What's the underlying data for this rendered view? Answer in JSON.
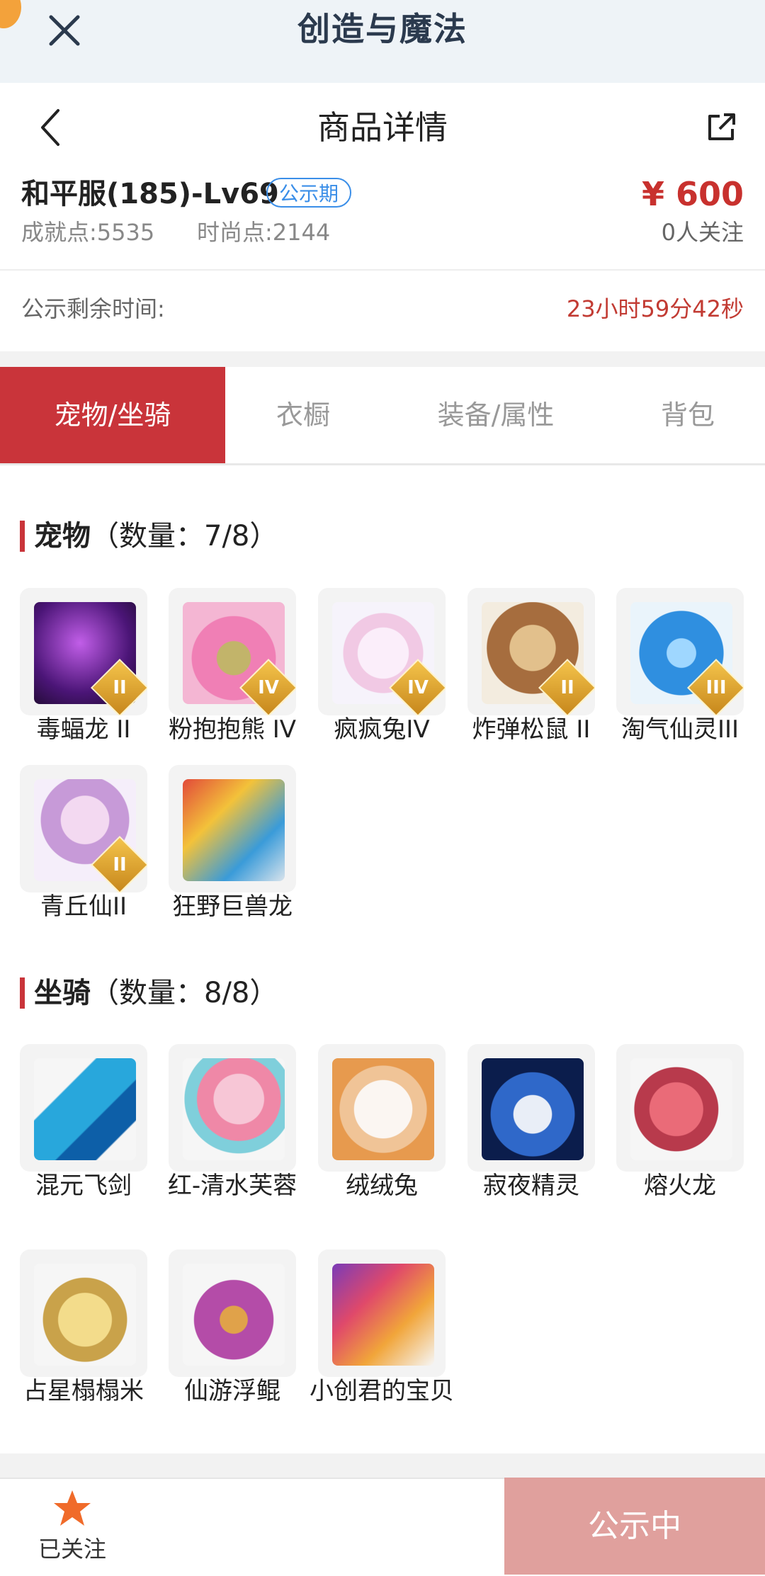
{
  "app": {
    "title": "创造与魔法"
  },
  "nav": {
    "title": "商品详情"
  },
  "item": {
    "name": "和平服(185)-Lv69",
    "badge": "公示期",
    "price": "¥ 600",
    "achievement_label": "成就点:",
    "achievement_value": "5535",
    "fashion_label": "时尚点:",
    "fashion_value": "2144",
    "followers": "0人关注"
  },
  "countdown": {
    "label": "公示剩余时间:",
    "value": "23小时59分42秒"
  },
  "tabs": [
    {
      "label": "宠物/坐骑"
    },
    {
      "label": "衣橱"
    },
    {
      "label": "装备/属性"
    },
    {
      "label": "背包"
    }
  ],
  "pets": {
    "title": "宠物",
    "count": "（数量：7/8）",
    "items": [
      {
        "name": "毒蝠龙 II",
        "tier": "II",
        "color": "#6a2aa8"
      },
      {
        "name": "粉抱抱熊 IV",
        "tier": "IV",
        "color": "#ea6fa8"
      },
      {
        "name": "疯疯兔IV",
        "tier": "IV",
        "color": "#f1d7ec"
      },
      {
        "name": "炸弹松鼠 II",
        "tier": "II",
        "color": "#c89a62"
      },
      {
        "name": "淘气仙灵III",
        "tier": "III",
        "color": "#3fa8e6"
      },
      {
        "name": "青丘仙II",
        "tier": "II",
        "color": "#e7c9ec"
      },
      {
        "name": "狂野巨兽龙",
        "tier": "",
        "color": "#d9a43a"
      }
    ]
  },
  "mounts": {
    "title": "坐骑",
    "count": "（数量：8/8）",
    "items": [
      {
        "name": "混元飞剑",
        "color": "#1f8fd6"
      },
      {
        "name": "红-清水芙蓉",
        "color": "#f29ab6"
      },
      {
        "name": "绒绒兔",
        "color": "#f3ebe6"
      },
      {
        "name": "寂夜精灵",
        "color": "#1a3f8a"
      },
      {
        "name": "熔火龙",
        "color": "#d24a5c"
      },
      {
        "name": "占星榻榻米",
        "color": "#e6c16a"
      },
      {
        "name": "仙游浮鲲",
        "color": "#a0449e"
      },
      {
        "name": "小创君的宝贝",
        "color": "#e98a3a"
      }
    ]
  },
  "bottom": {
    "follow_label": "已关注",
    "status_label": "公示中"
  }
}
